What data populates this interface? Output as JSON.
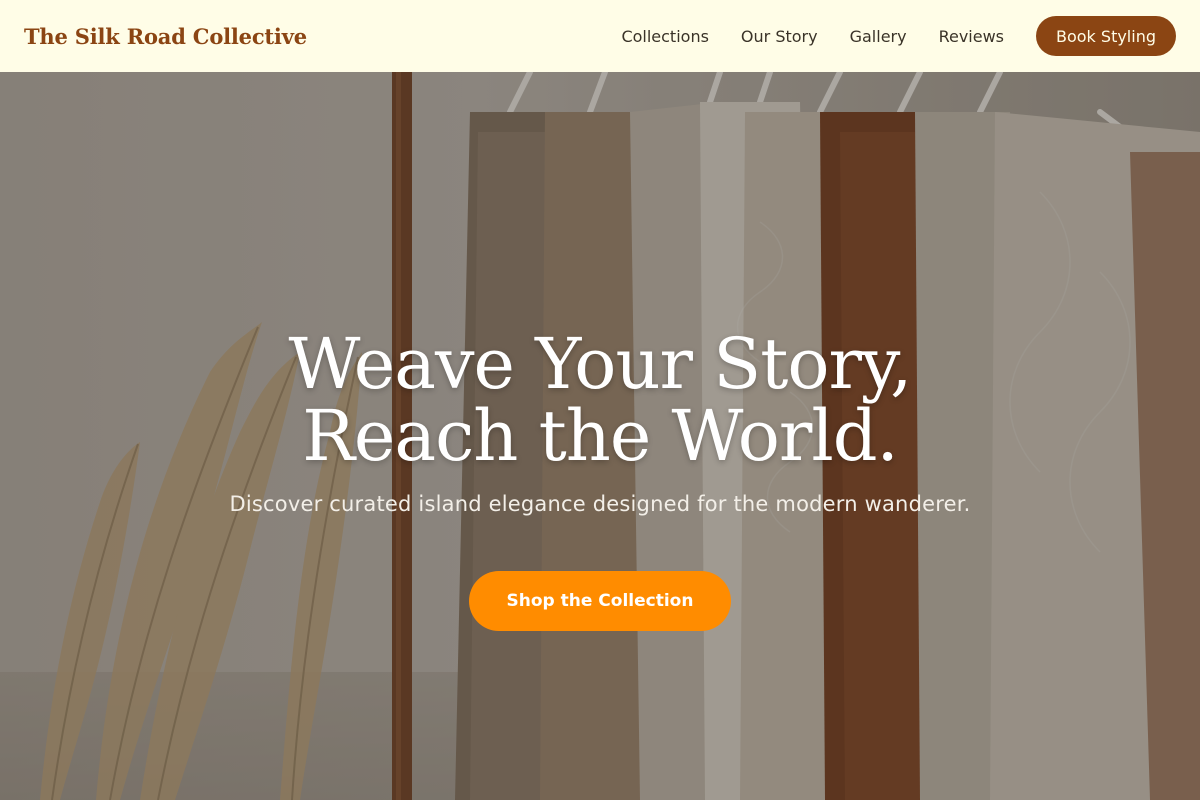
{
  "header": {
    "brand": "The Silk Road Collective",
    "nav": [
      "Collections",
      "Our Story",
      "Gallery",
      "Reviews"
    ],
    "cta_label": "Book Styling"
  },
  "hero": {
    "title": "Weave Your Story, Reach the World.",
    "subtitle": "Discover curated island elegance designed for the modern wanderer.",
    "cta_label": "Shop the Collection",
    "image_subject": "clothing-rack-with-knit-sweaters-and-pampas-grass"
  },
  "colors": {
    "header_bg": "#fffde7",
    "brand": "#8b4513",
    "book_button_bg": "#8b4513",
    "shop_button_bg": "#ff8c00",
    "hero_text": "#ffffff"
  }
}
